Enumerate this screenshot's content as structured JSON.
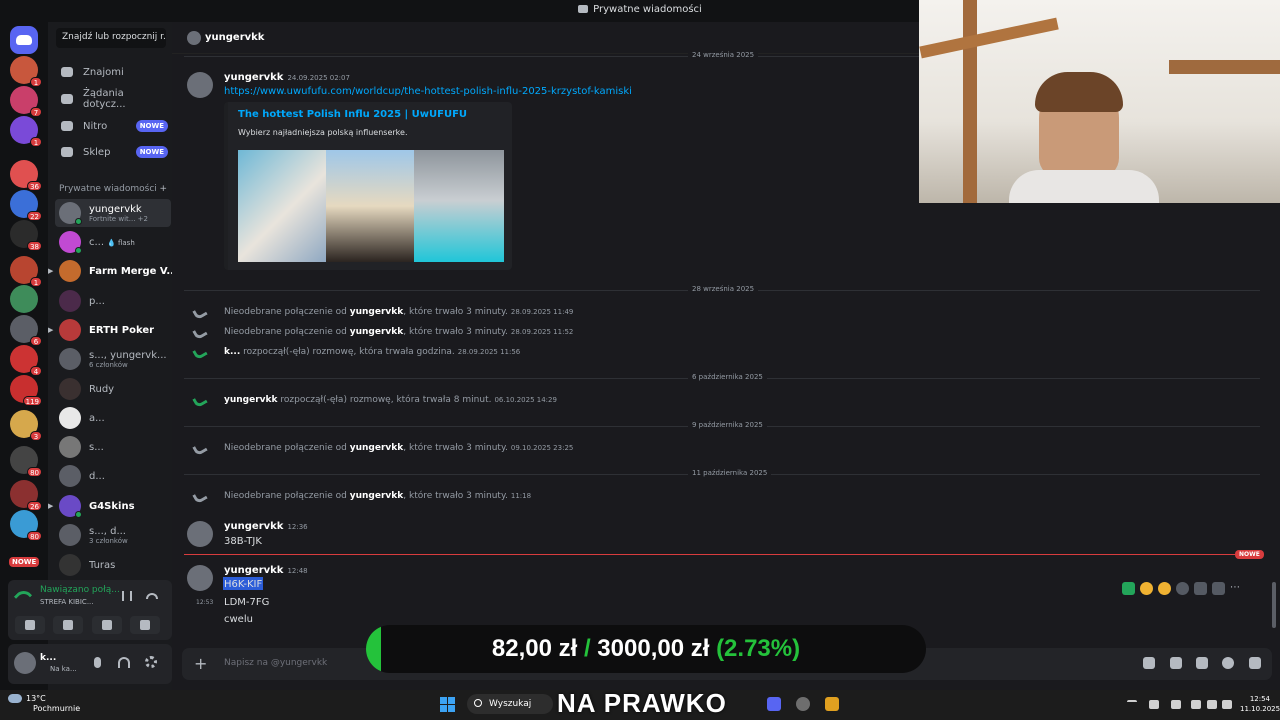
{
  "window_title": "Prywatne wiadomości",
  "sidebar": {
    "search_placeholder": "Znajdź lub rozpocznij r...",
    "nav": [
      {
        "label": "Znajomi",
        "badge": ""
      },
      {
        "label": "Żądania dotycz...",
        "badge": ""
      },
      {
        "label": "Nitro",
        "badge": "NOWE"
      },
      {
        "label": "Sklep",
        "badge": "NOWE"
      }
    ],
    "dm_header": "Prywatne wiadomości",
    "dms": [
      {
        "name": "yungervkk",
        "sub": "Fortnite wit...",
        "extra": "+2"
      },
      {
        "name": "c...",
        "sub": "",
        "extra": "💧 flash"
      },
      {
        "name": "Farm Merge V...",
        "sub": "",
        "extra": ""
      },
      {
        "name": "p...",
        "sub": "",
        "extra": ""
      },
      {
        "name": "ERTH Poker",
        "sub": "",
        "extra": ""
      },
      {
        "name": "s..., yungervk...",
        "sub": "6 członków",
        "extra": ""
      },
      {
        "name": "Rudy",
        "sub": "",
        "extra": ""
      },
      {
        "name": "a...",
        "sub": "",
        "extra": ""
      },
      {
        "name": "s...",
        "sub": "",
        "extra": ""
      },
      {
        "name": "d...",
        "sub": "",
        "extra": ""
      },
      {
        "name": "G4Skins",
        "sub": "",
        "extra": ""
      },
      {
        "name": "s..., d...",
        "sub": "3 członków",
        "extra": ""
      },
      {
        "name": "Turas",
        "sub": "",
        "extra": ""
      }
    ]
  },
  "server_badges": [
    "",
    "1",
    "7",
    "1",
    "36",
    "22",
    "38",
    "1",
    "",
    "6",
    "4",
    "119",
    "3",
    "80",
    "26",
    "80"
  ],
  "server_nowe": "NOWE",
  "voice": {
    "status": "Nawiązano połą...",
    "channel": "STREFA KIBIC..."
  },
  "user": {
    "name": "k...",
    "status": "Na ka..."
  },
  "chat": {
    "recipient": "yungervkk",
    "dates": [
      "24 września 2025",
      "28 września 2025",
      "6 października 2025",
      "9 października 2025",
      "11 października 2025"
    ],
    "msg1": {
      "author": "yungervkk",
      "time": "24.09.2025 02:07",
      "link": "https://www.uwufufu.com/worldcup/the-hottest-polish-influ-2025-krzystof-kamiski"
    },
    "embed": {
      "title": "The hottest Polish Influ 2025 | UwUFUFU",
      "desc": "Wybierz najładniejsza polską influenserke."
    },
    "calls": [
      {
        "pre": "Nieodebrane połączenie od",
        "who": "yungervkk",
        "post": ", które trwało 3 minuty.",
        "time": "28.09.2025 11:49",
        "type": "missed"
      },
      {
        "pre": "Nieodebrane połączenie od",
        "who": "yungervkk",
        "post": ", które trwało 3 minuty.",
        "time": "28.09.2025 11:52",
        "type": "missed"
      },
      {
        "pre": "",
        "who": "k...",
        "post": " rozpoczął(-ęła) rozmowę, która trwała godzina.",
        "time": "28.09.2025 11:56",
        "type": "call"
      },
      {
        "pre": "",
        "who": "yungervkk",
        "post": " rozpoczął(-ęła) rozmowę, która trwała 8 minut.",
        "time": "06.10.2025 14:29",
        "type": "call"
      },
      {
        "pre": "Nieodebrane połączenie od",
        "who": "yungervkk",
        "post": ", które trwało 3 minuty.",
        "time": "09.10.2025 23:25",
        "type": "missed"
      },
      {
        "pre": "Nieodebrane połączenie od",
        "who": "yungervkk",
        "post": ", które trwało 3 minuty.",
        "time": "11:18",
        "type": "missed"
      }
    ],
    "msg2": {
      "author": "yungervkk",
      "time": "12:36",
      "text": "38B-TJK"
    },
    "new_badge": "NOWE",
    "msg3": {
      "author": "yungervkk",
      "time": "12:48",
      "lines": [
        "H6K-KIF",
        "LDM-7FG",
        "cwelu"
      ],
      "side_time": "12:53"
    },
    "composer_placeholder": "Napisz na @yungervkk"
  },
  "goal": {
    "current": "82,00 zł",
    "slash": "/",
    "target": "3000,00 zł",
    "percent": "(2.73%)",
    "fraction": 0.0273
  },
  "taskbar": {
    "temp": "13°C",
    "weather": "Pochmurnie",
    "search": "Wyszukaj",
    "overlay": "NA PRAWKO",
    "time": "12:54",
    "date": "11.10.2025"
  },
  "colors": {
    "accent": "#5865f2",
    "green": "#23a55a",
    "red": "#d83c3e",
    "link": "#00a8fc",
    "goal": "#24c23b"
  }
}
